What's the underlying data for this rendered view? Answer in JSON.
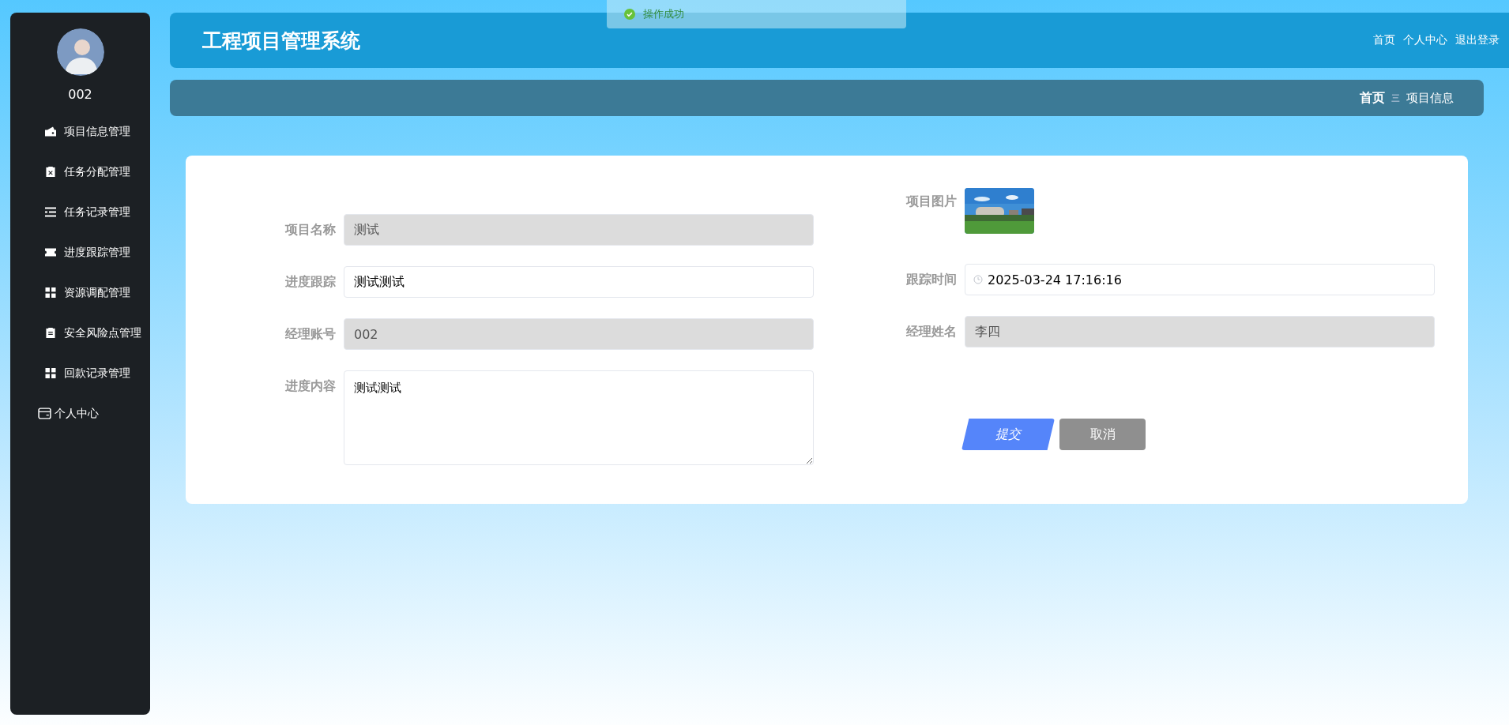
{
  "toast": {
    "text": "操作成功"
  },
  "sidebar": {
    "username": "002",
    "items": [
      {
        "label": "项目信息管理",
        "kind": "wallet"
      },
      {
        "label": "任务分配管理",
        "kind": "clipboardx"
      },
      {
        "label": "任务记录管理",
        "kind": "list"
      },
      {
        "label": "进度跟踪管理",
        "kind": "ticket"
      },
      {
        "label": "资源调配管理",
        "kind": "grid"
      },
      {
        "label": "安全风险点管理",
        "kind": "clipboard"
      },
      {
        "label": "回款记录管理",
        "kind": "grid"
      }
    ],
    "profile_link": "个人中心"
  },
  "header": {
    "title": "工程项目管理系统",
    "links": [
      "首页",
      "个人中心",
      "退出登录"
    ]
  },
  "breadcrumb": {
    "home": "首页",
    "separator": "三",
    "current": "项目信息"
  },
  "form": {
    "left": [
      {
        "label": "项目名称",
        "kind": "text",
        "value": "测试",
        "disabled": true
      },
      {
        "label": "进度跟踪",
        "kind": "text",
        "value": "测试测试",
        "disabled": false
      },
      {
        "label": "经理账号",
        "kind": "text",
        "value": "002",
        "disabled": true
      },
      {
        "label": "进度内容",
        "kind": "textarea",
        "value": "测试测试",
        "disabled": false
      }
    ],
    "right": [
      {
        "label": "项目图片"
      },
      {
        "label": "跟踪时间",
        "kind": "date",
        "value": "2025-03-24 17:16:16",
        "disabled": false
      },
      {
        "label": "经理姓名",
        "kind": "text",
        "value": "李四",
        "disabled": true
      }
    ],
    "buttons": [
      {
        "label": "提交",
        "kind": "primary"
      },
      {
        "label": "取消",
        "kind": "secondary"
      }
    ]
  }
}
